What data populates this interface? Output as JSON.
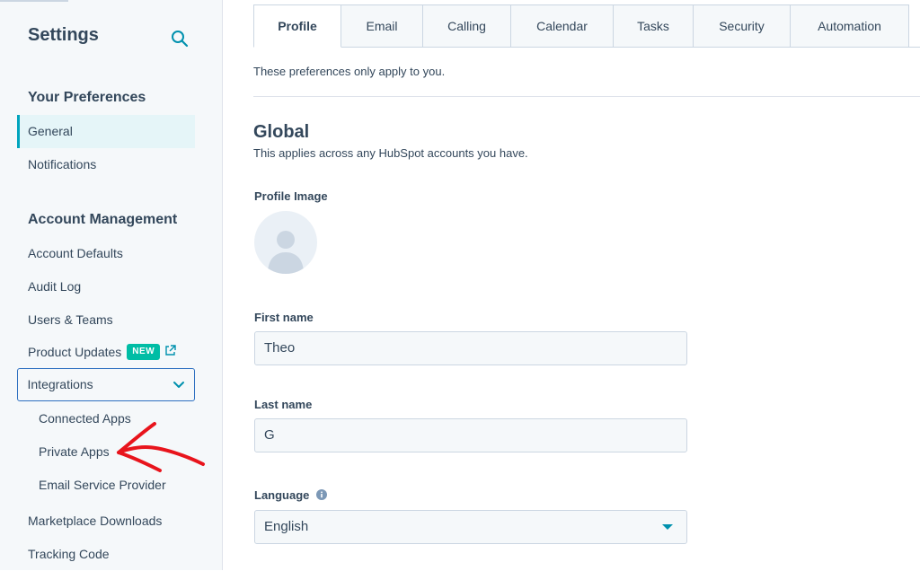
{
  "sidebar": {
    "title": "Settings",
    "your_preferences_heading": "Your Preferences",
    "preferences_items": [
      "General",
      "Notifications"
    ],
    "account_management_heading": "Account Management",
    "account_items": [
      "Account Defaults",
      "Audit Log",
      "Users & Teams"
    ],
    "product_updates": {
      "label": "Product Updates",
      "badge": "NEW"
    },
    "integrations": {
      "label": "Integrations",
      "children": [
        "Connected Apps",
        "Private Apps",
        "Email Service Provider"
      ]
    },
    "more_items": [
      "Marketplace Downloads",
      "Tracking Code"
    ]
  },
  "tabs": [
    "Profile",
    "Email",
    "Calling",
    "Calendar",
    "Tasks",
    "Security",
    "Automation"
  ],
  "active_tab": "Profile",
  "note": "These preferences only apply to you.",
  "global": {
    "heading": "Global",
    "description": "This applies across any HubSpot accounts you have."
  },
  "profile_image_label": "Profile Image",
  "first_name": {
    "label": "First name",
    "value": "Theo"
  },
  "last_name": {
    "label": "Last name",
    "value": "G"
  },
  "language": {
    "label": "Language",
    "value": "English"
  },
  "colors": {
    "accent_teal": "#00a4bd",
    "badge_green": "#00bda5",
    "text": "#33475b",
    "focus_blue": "#2d6fc0",
    "annotation_red": "#e8141c"
  }
}
